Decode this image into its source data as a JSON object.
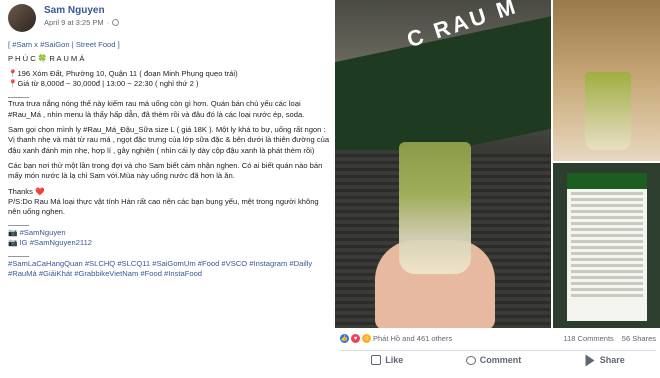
{
  "post": {
    "author": "Sam Nguyen",
    "timestamp": "April 9 at 3:25 PM",
    "lines": [
      "[ #Sam x #SaiGon | Street Food ]",
      "P H Ú C 🍀 R A U M Á",
      "📍196 Xóm Đất, Phường 10, Quận 11 ( đoạn Minh Phụng quẹo trái)",
      "📍Giá từ 8,000đ ~ 30,000đ | 13:00 ~ 22:30 ( nghỉ thứ 2 )",
      "_____",
      "Trưa trưa nắng nóng thế này kiếm rau má uống còn gì hơn. Quán bán chủ yếu các loại #Rau_Má , nhìn menu là thấy hấp dẫn, đã thèm rồi và đâu đó là các loại nước ép, soda.",
      "Sam gọi chọn mình ly #Rau_Má_Đậu_Sữa size L ( giá 18K ). Một ly khá to bự, uống rất ngon : Vị thanh nhẹ và mát từ rau má , ngọt đặc trưng của lớp sữa đặc & bên dưới là thiên đường của đậu xanh đánh mịn nhẹ, hợp lí , gây nghiện ( nhìn cái ly dày cộp đậu xanh là phát thèm rồi)",
      "Các bạn nơi thử một lần trong đợi và cho Sam biết cảm nhận nghen. Có ai biết quán nào bán mấy món nước là lạ chỉ Sam với.Mùa này uống nước đã hơn là ăn.",
      "Thanks ❤️",
      "P/S:Do Rau Má loại thực vật tính Hàn rất cao nên các bạn bụng yếu, mệt trong người không nên uống nghen.",
      "_____",
      "📷 #SamNguyen",
      "📷 IG #SamNguyen2112",
      "_____",
      "#SamLaCaHangQuan #SLCHQ #SLCQ11 #SaiGomUm #Food #VSCO #Instagram #Dailly #RauMá #GiảiKhát #GrabbikeVietNam #Food #InstaFood"
    ]
  },
  "reactions": {
    "summary": "Phát Hồ and 461 others",
    "comments": "118 Comments",
    "shares": "56 Shares"
  },
  "buttons": {
    "like": "Like",
    "comment": "Comment",
    "share": "Share"
  },
  "photo": {
    "sign_text": "C RAU M"
  }
}
